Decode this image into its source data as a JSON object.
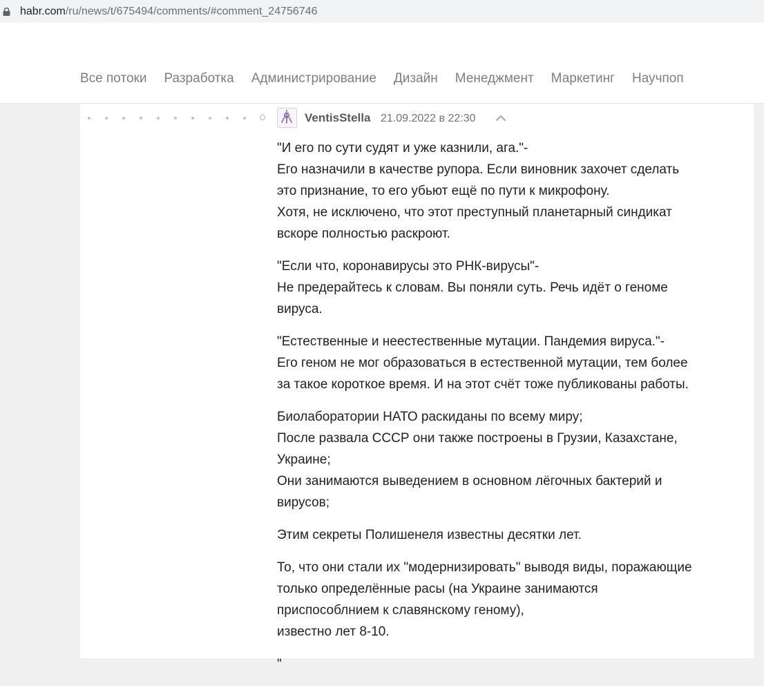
{
  "browser": {
    "url_host": "habr.com",
    "url_path": "/ru/news/t/675494/comments/#comment_24756746"
  },
  "nav": {
    "items": [
      "Все потоки",
      "Разработка",
      "Администрирование",
      "Дизайн",
      "Менеджмент",
      "Маркетинг",
      "Научпоп"
    ]
  },
  "comment": {
    "author": "VentisStella",
    "timestamp": "21.09.2022 в 22:30",
    "avatar_icon": "robot-avatar-icon",
    "parent_icon": "chevron-up-icon",
    "paragraphs": [
      "\"И его по сути судят и уже казнили, ага.\"-\nЕго назначили в качестве рупора. Если виновник захочет сделать\nэто признание, то его убьют ещё по пути к микрофону.\nХотя, не исключено, что этот преступный планетарный синдикат\nвскоре полностью раскроют.",
      "\"Если что, коронавирусы это РНК-вирусы\"-\nНе предерайтесь к словам. Вы поняли суть. Речь идёт о геноме\nвируса.",
      "\"Естественные и неестественные мутации. Пандемия вируса.\"-\nЕго геном не мог образоваться в естественной мутации, тем более\nза такое короткое время. И на этот счёт тоже публикованы работы.",
      "Биолаборатории НАТО раскиданы по всему миру;\nПосле развала СССР они также построены в Грузии, Казахстане,\nУкраине;\nОни занимаются выведением в основном лёгочных бактерий и\nвирусов;",
      "Этим секреты Полишенеля известны десятки лет.",
      "То, что они стали их \"модернизировать\" выводя виды, поражающие\nтолько определённые расы (на Украине занимаются\nприспособлнием к славянскому геному),\nизвестно лет 8-10.",
      "\""
    ]
  },
  "colors": {
    "nav_text": "#7b8085",
    "author": "#555b61",
    "body_text": "#222222",
    "page_bg": "#f0f0f0"
  }
}
